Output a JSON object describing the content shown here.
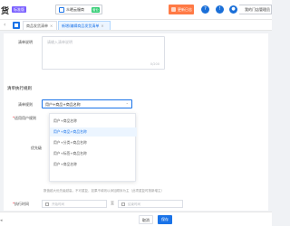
{
  "header": {
    "logo": "货",
    "version_badge": "标准版",
    "store_name": "众晒云服商",
    "store_badge": "营业",
    "orange_button": "更新日志",
    "help_icon": "?",
    "bell_icon": "!",
    "user_icon": "●",
    "user_name": "我的门店管理员"
  },
  "tabs": {
    "back": "‹",
    "items": [
      {
        "label": "商品发货清单",
        "close": "×"
      },
      {
        "label": "新增/编辑商品发货清单",
        "close": "×"
      }
    ]
  },
  "form": {
    "remark_label": "清单说明",
    "remark_placeholder": "请输入清单说明",
    "remark_counter": "0/200",
    "section_title": "清单执行规则",
    "rule_label": "清单规则",
    "rule_selected": "用户+商品+商品名称",
    "apply_label": "适用用户规则",
    "priority_label": "优先级",
    "priority_hint": "数值越大优先级越高，不可重复，如果不填则以添加顺序为主（此项重复时按新增主）",
    "time_label": "执行时间",
    "time_start_placeholder": "开始时间",
    "time_separator": "至",
    "time_end_placeholder": "结束时间"
  },
  "dropdown": {
    "options": [
      {
        "label": "用户+商品名称",
        "selected": false
      },
      {
        "label": "用户+商品+商品名称",
        "selected": true
      },
      {
        "label": "用户+分类+商品名称",
        "selected": false
      },
      {
        "label": "用户+标签+商品名称",
        "selected": false
      },
      {
        "label": "用户+商品名称",
        "selected": false
      }
    ]
  },
  "footer": {
    "cancel": "取消",
    "save": "保存"
  },
  "colors": {
    "primary": "#1a73e8",
    "orange": "#ff7a45",
    "badge_purple": "#7b61ff",
    "badge_green": "#2ecc71"
  }
}
